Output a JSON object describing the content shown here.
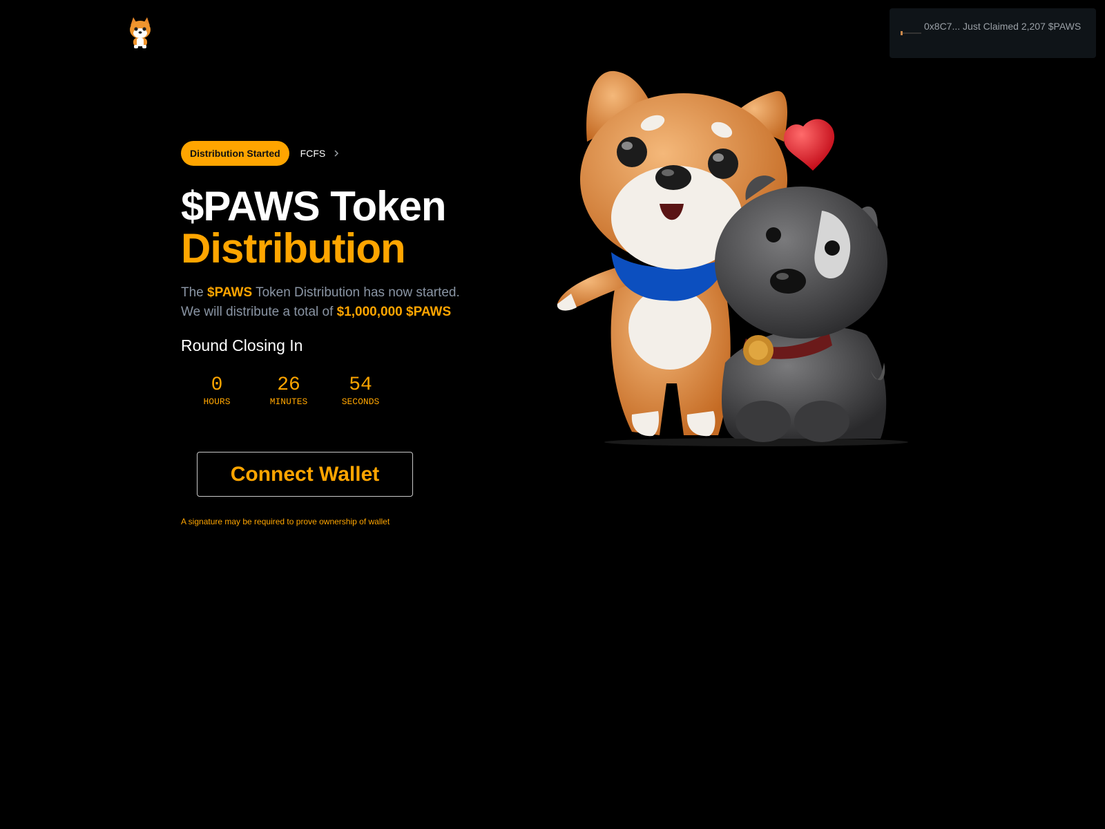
{
  "header": {
    "logo_icon": "shiba-mascot-icon"
  },
  "toast": {
    "message": "0x8C7... Just Claimed 2,207 $PAWS"
  },
  "badges": {
    "status": "Distribution Started",
    "link": "FCFS",
    "link_icon": "chevron-right-icon"
  },
  "title": {
    "line1": "$PAWS Token",
    "line2": "Distribution"
  },
  "description": {
    "part1": "The ",
    "token": "$PAWS",
    "part2": " Token Distribution has now started.",
    "part3": "We will distribute a total of ",
    "amount": "$1,000,000 $PAWS"
  },
  "countdown": {
    "label": "Round Closing In",
    "hours": "0",
    "hours_label": "HOURS",
    "minutes": "26",
    "minutes_label": "MINUTES",
    "seconds": "54",
    "seconds_label": "SECONDS"
  },
  "connect_button": {
    "label": "Connect Wallet"
  },
  "signature_note": "A signature may be required to prove ownership of wallet",
  "colors": {
    "accent": "#ffa500",
    "background": "#000000",
    "toast_bg": "#0f1418",
    "muted_text": "#8a95a4"
  }
}
